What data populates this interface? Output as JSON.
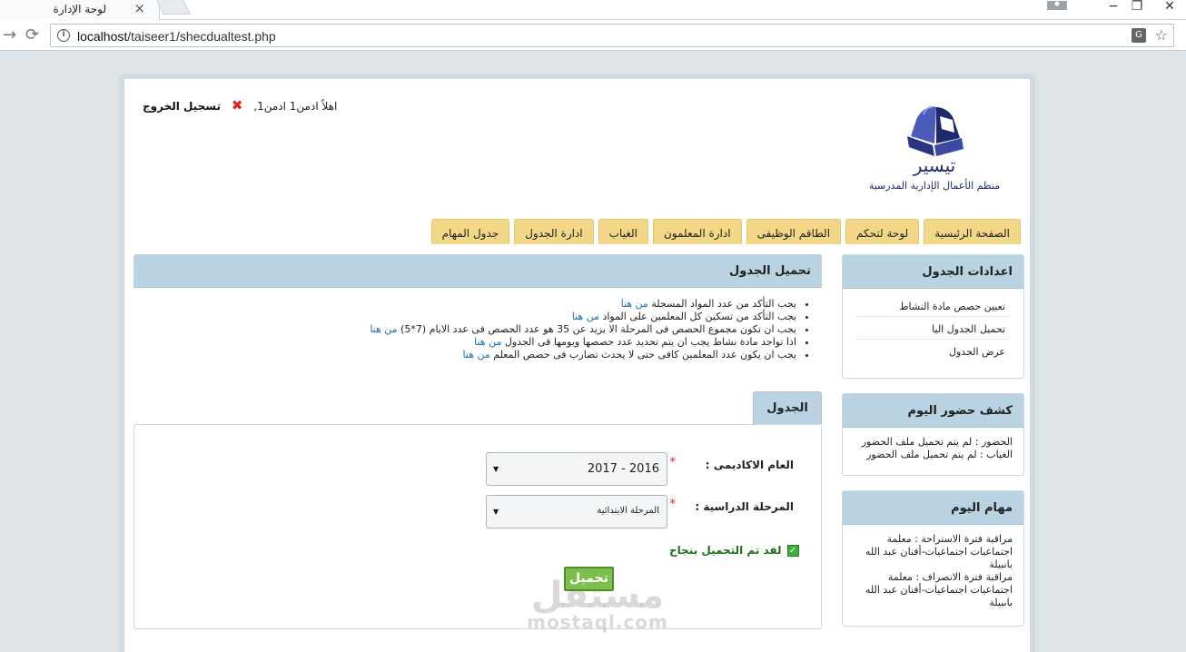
{
  "browser": {
    "tab_title": "لوحة الإدارة",
    "url_host": "localhost",
    "url_path": "/taiseer1/shecdualtest.php"
  },
  "header": {
    "greeting": "اهلاً ادمن1 ادمن1,",
    "logout": "تسجيل الخروج",
    "logo_name": "تيسير",
    "logo_tagline": "منظم الأعمال الإدارية المدرسية"
  },
  "nav": [
    "الصفحة الرئيسية",
    "لوحة لتحكم",
    "الطاقم الوظيفى",
    "ادارة المعلمون",
    "الغياب",
    "ادارة الجدول",
    "جدول المهام"
  ],
  "sidebar": {
    "settings_title": "اعدادات الجدول",
    "settings_links": [
      "تعيين حصص مادة النشاط",
      "تحميل الجدول اليا",
      "عرض الجدول"
    ],
    "attendance_title": "كشف حضور اليوم",
    "attendance_lines": [
      "الحضور : لم يتم تحميل ملف الحضور",
      "الغياب : لم يتم تحميل ملف الحضور"
    ],
    "tasks_title": "مهام اليوم",
    "tasks_lines": [
      "مراقبة فترة الاستراحة : معلمة اجتماعيات اجتماعيات-أفنان عبد الله بانبيلة",
      "مراقبة فترة الانصراف : معلمة اجتماعيات اجتماعيات-أفنان عبد الله بانبيلة"
    ]
  },
  "main": {
    "load_title": "تحميل الجدول",
    "link_text": "من هنا",
    "checks": [
      "يجب التأكد من عدد المواد المسجلة",
      "يجب التأكد من تسكين كل المعلمين على المواد",
      "يجب ان تكون مجموع الحصص فى المرحلة الا يزيد عن 35 هو عدد الحصص فى عدد الايام (7*5)",
      "اذا تواجد مادة نشاط يجب ان يتم تحديد عدد حصصها ويومها فى الجدول",
      "يجب ان يكون عدد المعلمين كافى حتى لا يحدث تضارب فى حصص المعلم"
    ],
    "table_title": "الجدول",
    "year_label": "العام الاكاديمى :",
    "year_value": "2016 - 2017",
    "stage_label": "المرحلة الدراسية :",
    "stage_value": "المرحلة الابتدائية",
    "required_mark": "*",
    "success_msg": "لقد تم التحميل بنجاح",
    "load_button": "تحميل",
    "watermark_ar": "مستقل",
    "watermark_en": "mostaql.com"
  }
}
